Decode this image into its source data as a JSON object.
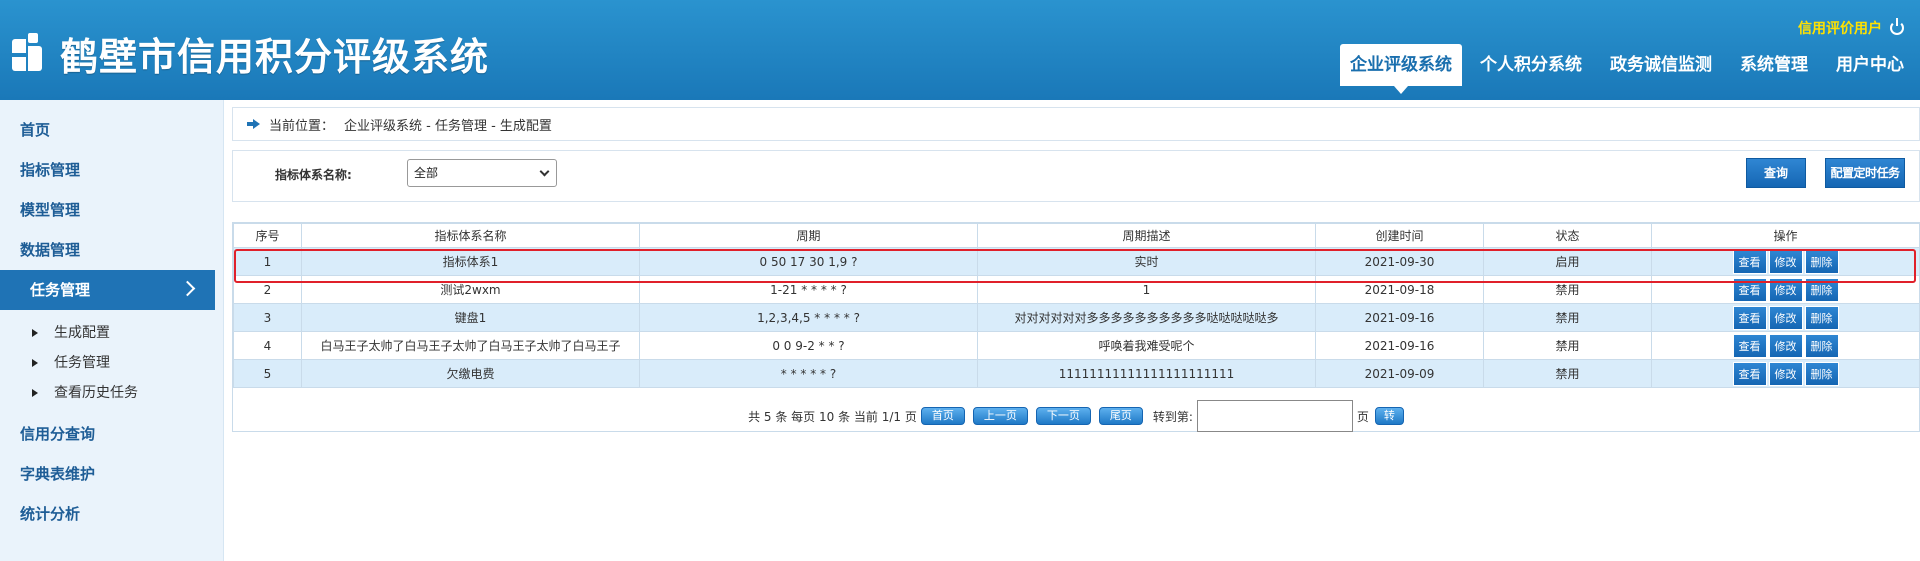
{
  "header": {
    "title": "鹤壁市信用积分评级系统",
    "user_label": "信用评价用户",
    "nav": [
      {
        "label": "企业评级系统",
        "active": true
      },
      {
        "label": "个人积分系统"
      },
      {
        "label": "政务诚信监测"
      },
      {
        "label": "系统管理"
      },
      {
        "label": "用户中心"
      }
    ]
  },
  "sidebar": {
    "items": [
      {
        "label": "首页"
      },
      {
        "label": "指标管理"
      },
      {
        "label": "模型管理"
      },
      {
        "label": "数据管理"
      },
      {
        "label": "任务管理",
        "active": true
      },
      {
        "label": "信用分查询"
      },
      {
        "label": "字典表维护"
      },
      {
        "label": "统计分析"
      }
    ],
    "sub_items": [
      {
        "label": "生成配置"
      },
      {
        "label": "任务管理"
      },
      {
        "label": "查看历史任务"
      }
    ]
  },
  "breadcrumb": {
    "label": "当前位置：",
    "path": "企业评级系统 - 任务管理 - 生成配置"
  },
  "filter": {
    "label": "指标体系名称:",
    "select_value": "全部",
    "query_button": "查询",
    "schedule_button": "配置定时任务"
  },
  "table": {
    "headers": [
      "序号",
      "指标体系名称",
      "周期",
      "周期描述",
      "创建时间",
      "状态",
      "操作"
    ],
    "rows": [
      {
        "no": "1",
        "name": "指标体系1",
        "cycle": "0 50 17 30 1,9 ?",
        "desc": "实时",
        "created": "2021-09-30",
        "status": "启用"
      },
      {
        "no": "2",
        "name": "测试2wxm",
        "cycle": "1-21 * * * * ?",
        "desc": "1",
        "created": "2021-09-18",
        "status": "禁用"
      },
      {
        "no": "3",
        "name": "键盘1",
        "cycle": "1,2,3,4,5 * * * * ?",
        "desc": "对对对对对对多多多多多多多多多多哒哒哒哒哒多",
        "created": "2021-09-16",
        "status": "禁用"
      },
      {
        "no": "4",
        "name": "白马王子太帅了白马王子太帅了白马王子太帅了白马王子",
        "cycle": "0 0 9-2 * * ?",
        "desc": "呼唤着我难受呢个",
        "created": "2021-09-16",
        "status": "禁用"
      },
      {
        "no": "5",
        "name": "欠缴电费",
        "cycle": "* * * * * ?",
        "desc": "11111111111111111111111",
        "created": "2021-09-09",
        "status": "禁用"
      }
    ],
    "actions": {
      "view": "查看",
      "edit": "修改",
      "delete": "删除"
    }
  },
  "pager": {
    "summary": "共 5 条 每页 10 条 当前 1/1 页",
    "first": "首页",
    "prev": "上一页",
    "next": "下一页",
    "last": "尾页",
    "goto_label": "转到第:",
    "page_unit": "页",
    "go": "转"
  }
}
